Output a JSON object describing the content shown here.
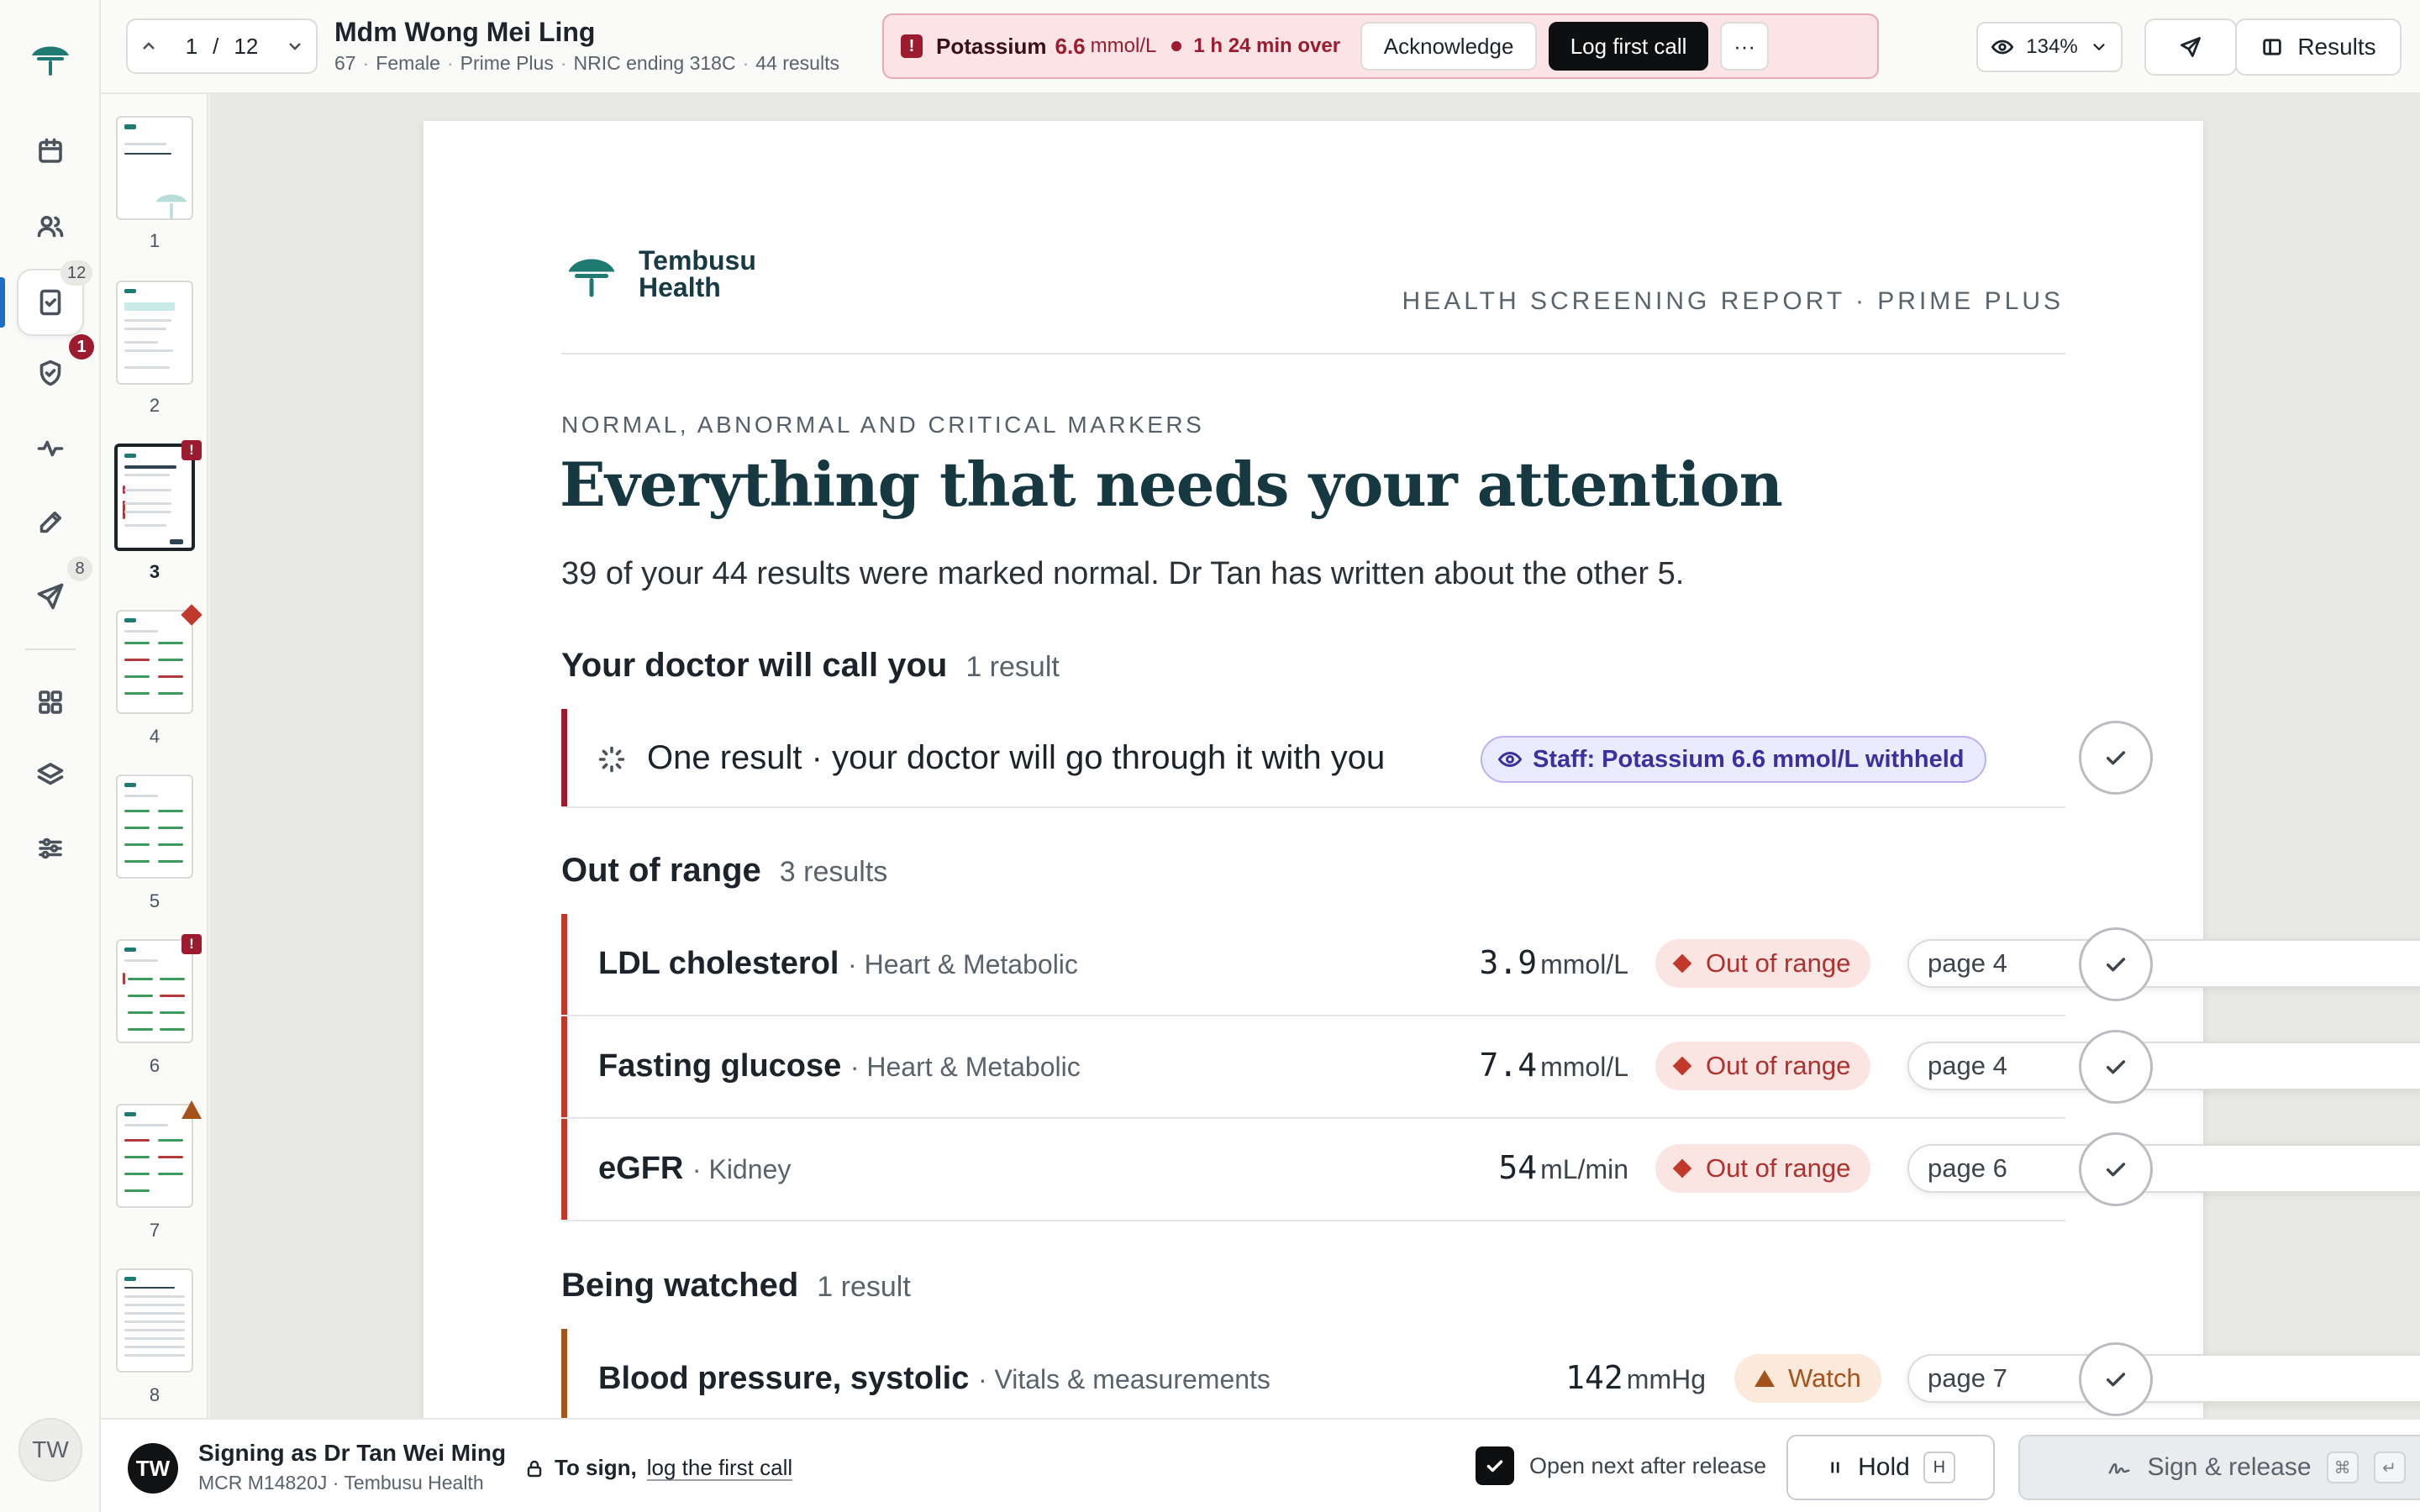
{
  "colors": {
    "brand_teal": "#1f7a72",
    "critical": "#9c1b2e",
    "out_of_range": "#c0392b",
    "watch": "#a5521b",
    "staff_purple": "#3c2f9e"
  },
  "rail": {
    "items": [
      {
        "name": "calendar-icon"
      },
      {
        "name": "users-icon"
      },
      {
        "name": "document-check-icon",
        "badge": "12",
        "active": true
      },
      {
        "name": "shield-check-icon",
        "badge": "1"
      },
      {
        "name": "activity-icon"
      },
      {
        "name": "pen-icon"
      },
      {
        "name": "send-icon",
        "badge": "8"
      },
      {
        "name": "grid-icon"
      },
      {
        "name": "layers-icon"
      },
      {
        "name": "sliders-icon"
      }
    ],
    "avatar": "TW"
  },
  "pager": {
    "current": "1",
    "separator": "/",
    "total": "12"
  },
  "patient": {
    "name": "Mdm Wong Mei Ling",
    "age": "67",
    "sex": "Female",
    "plan": "Prime Plus",
    "nric": "NRIC ending 318C",
    "results": "44 results"
  },
  "alert": {
    "analyte": "Potassium",
    "value": "6.6",
    "unit": "mmol/L",
    "overdue": "1 h 24 min over",
    "acknowledge_label": "Acknowledge",
    "log_label": "Log first call",
    "more_label": "···"
  },
  "toolbar": {
    "zoom": "134%",
    "results_label": "Results"
  },
  "thumbnails": [
    {
      "num": "1",
      "flag": ""
    },
    {
      "num": "2",
      "flag": ""
    },
    {
      "num": "3",
      "flag": "critical",
      "selected": true
    },
    {
      "num": "4",
      "flag": "diamond"
    },
    {
      "num": "5",
      "flag": ""
    },
    {
      "num": "6",
      "flag": "critical"
    },
    {
      "num": "7",
      "flag": "triangle"
    },
    {
      "num": "8",
      "flag": ""
    }
  ],
  "doc": {
    "brand_line1": "Tembusu",
    "brand_line2": "Health",
    "header": "HEALTH SCREENING REPORT · PRIME PLUS",
    "eyebrow": "NORMAL, ABNORMAL AND CRITICAL MARKERS",
    "headline": "Everything that needs your attention",
    "lede": "39 of your 44 results were marked normal. Dr Tan has written about the other 5.",
    "call_section": {
      "title": "Your doctor will call you",
      "count": "1 result",
      "row_text": "One result · your doctor will go through it with you",
      "staff_note": "Staff: Potassium 6.6 mmol/L withheld"
    },
    "oor_section": {
      "title": "Out of range",
      "count": "3 results",
      "rows": [
        {
          "name": "LDL cholesterol",
          "category": "· Heart & Metabolic",
          "value": "3.9",
          "unit": "mmol/L",
          "status": "Out of range",
          "page": "page 4"
        },
        {
          "name": "Fasting glucose",
          "category": "· Heart & Metabolic",
          "value": "7.4",
          "unit": "mmol/L",
          "status": "Out of range",
          "page": "page 4"
        },
        {
          "name": "eGFR",
          "category": "· Kidney",
          "value": "54",
          "unit": "mL/min",
          "status": "Out of range",
          "page": "page 6"
        }
      ]
    },
    "watch_section": {
      "title": "Being watched",
      "count": "1 result",
      "rows": [
        {
          "name": "Blood pressure, systolic",
          "category": "· Vitals & measurements",
          "value": "142",
          "unit": "mmHg",
          "status": "Watch",
          "page": "page 7"
        }
      ]
    }
  },
  "footer": {
    "signer_initials": "TW",
    "signer_name": "Signing as Dr Tan Wei Ming",
    "signer_meta": "MCR M14820J · Tembusu Health",
    "to_sign_prefix": "To sign,",
    "to_sign_link": "log the first call",
    "open_next_label": "Open next after release",
    "hold_label": "Hold",
    "hold_key": "H",
    "sign_label": "Sign & release",
    "sign_key1": "⌘",
    "sign_key2": "↵"
  }
}
